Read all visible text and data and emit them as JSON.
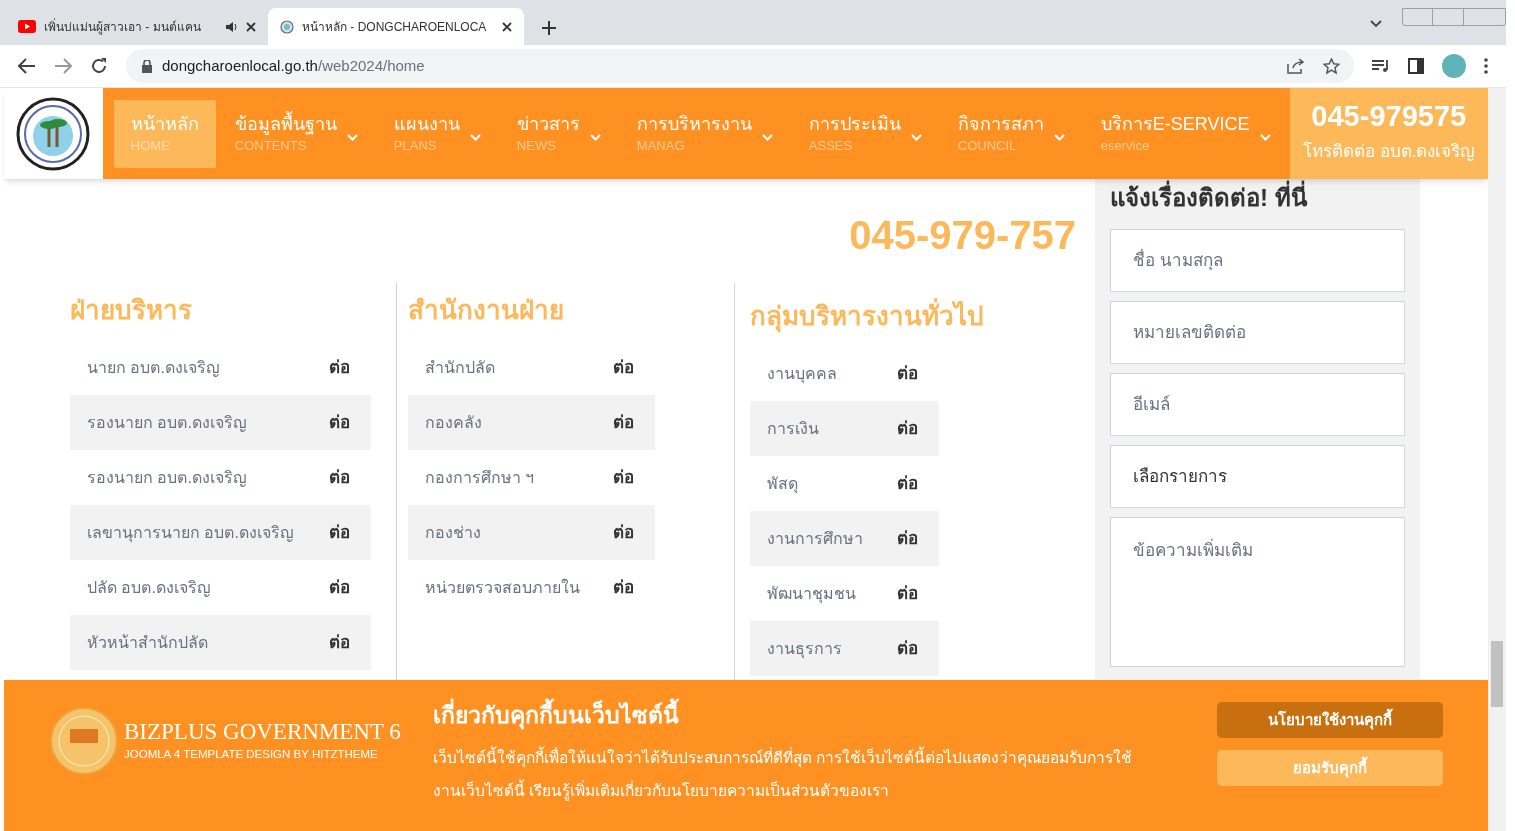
{
  "browser": {
    "tabs": [
      {
        "kind": "video",
        "title": "เพิ่นบ่แม่นผู้สาวเอา - มนต์แคน",
        "audio": true,
        "selected": false
      },
      {
        "kind": "site",
        "title": "หน้าหลัก - DONGCHAROENLOCA",
        "audio": false,
        "selected": true
      }
    ],
    "url": {
      "domain": "dongcharoenlocal.go.th",
      "path": "/web2024/home"
    }
  },
  "nav": {
    "items": [
      {
        "label": "หน้าหลัก",
        "sub": "HOME",
        "selected": true,
        "has_menu": false
      },
      {
        "label": "ข้อมูลพื้นฐาน",
        "sub": "CONTENTS",
        "selected": false,
        "has_menu": true
      },
      {
        "label": "แผนงาน",
        "sub": "PLANS",
        "selected": false,
        "has_menu": true
      },
      {
        "label": "ข่าวสาร",
        "sub": "NEWS",
        "selected": false,
        "has_menu": true
      },
      {
        "label": "การบริหารงาน",
        "sub": "MANAG",
        "selected": false,
        "has_menu": true
      },
      {
        "label": "การประเมิน",
        "sub": "ASSES",
        "selected": false,
        "has_menu": true
      },
      {
        "label": "กิจการสภา",
        "sub": "COUNCIL",
        "selected": false,
        "has_menu": true
      },
      {
        "label": "บริการE-SERVICE",
        "sub": "eservice",
        "selected": false,
        "has_menu": true
      }
    ],
    "phone": {
      "number": "045-979575",
      "caption": "โทรติดต่อ อบต.ดงเจริญ"
    }
  },
  "hotline": "045-979-757",
  "columns": [
    {
      "title": "ฝ่ายบริหาร",
      "rows": [
        {
          "label": "นายก อบต.ดงเจริญ",
          "link": "ต่อ"
        },
        {
          "label": "รองนายก อบต.ดงเจริญ",
          "link": "ต่อ"
        },
        {
          "label": "รองนายก อบต.ดงเจริญ",
          "link": "ต่อ"
        },
        {
          "label": "เลขานุการนายก อบต.ดงเจริญ",
          "link": "ต่อ"
        },
        {
          "label": "ปลัด อบต.ดงเจริญ",
          "link": "ต่อ"
        },
        {
          "label": "หัวหน้าสำนักปลัด",
          "link": "ต่อ"
        }
      ]
    },
    {
      "title": "สำนักงานฝ่าย",
      "rows": [
        {
          "label": "สำนักปลัด",
          "link": "ต่อ"
        },
        {
          "label": "กองคลัง",
          "link": "ต่อ"
        },
        {
          "label": "กองการศึกษา ฯ",
          "link": "ต่อ"
        },
        {
          "label": "กองช่าง",
          "link": "ต่อ"
        },
        {
          "label": "หน่วยตรวจสอบภายใน",
          "link": "ต่อ"
        }
      ]
    },
    {
      "title": "กลุ่มบริหารงานทั่วไป",
      "rows": [
        {
          "label": "งานบุคคล",
          "link": "ต่อ"
        },
        {
          "label": "การเงิน",
          "link": "ต่อ"
        },
        {
          "label": "พัสดุ",
          "link": "ต่อ"
        },
        {
          "label": "งานการศึกษา",
          "link": "ต่อ"
        },
        {
          "label": "พัฒนาชุมชน",
          "link": "ต่อ"
        },
        {
          "label": "งานธุรการ",
          "link": "ต่อ"
        }
      ]
    }
  ],
  "contact": {
    "title": "แจ้งเรื่องติดต่อ! ที่นี่",
    "fields": [
      {
        "kind": "input",
        "placeholder": "ชื่อ นามสกุล"
      },
      {
        "kind": "input",
        "placeholder": "หมายเลขติดต่อ"
      },
      {
        "kind": "input",
        "placeholder": "อีเมล์"
      },
      {
        "kind": "select",
        "value": "เลือกรายการ"
      },
      {
        "kind": "textarea",
        "placeholder": "ข้อความเพิ่มเติม"
      }
    ]
  },
  "cookie": {
    "brand": "BIZPLUS GOVERNMENT 6",
    "brand_sub": "JOOMLA 4 TEMPLATE DESIGN BY HITZTHEME",
    "title": "เกี่ยวกับคุกกี้บนเว็บไซต์นี้",
    "text": "เว็บไซต์นี้ใช้คุกกี้เพื่อให้แน่ใจว่าได้รับประสบการณ์ที่ดีที่สุด การใช้เว็บไซต์นี้ต่อไปแสดงว่าคุณยอมรับการใช้งานเว็บไซต์นี้ เรียนรู้เพิ่มเติมเกี่ยวกับนโยบายความเป็นส่วนตัวของเรา",
    "buttons": [
      {
        "kind": "primary",
        "label": "นโยบายใช้งานคุกกี้"
      },
      {
        "kind": "secondary",
        "label": "ยอมรับคุกกี้"
      }
    ]
  }
}
